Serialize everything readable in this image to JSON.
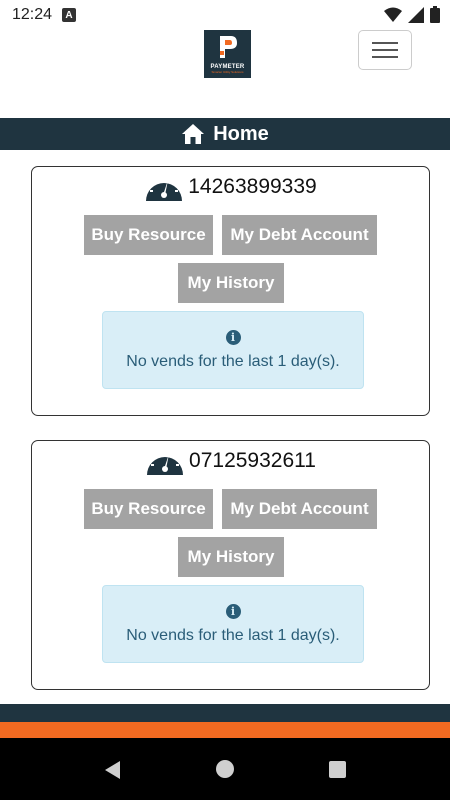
{
  "status_bar": {
    "time": "12:24",
    "notification_badge": "A",
    "icons": [
      "wifi-icon",
      "signal-icon",
      "battery-icon"
    ]
  },
  "header": {
    "logo_text": "PAYMETER",
    "logo_subtext": "Smarter Utility Solutions",
    "menu_icon": "hamburger-icon"
  },
  "nav": {
    "title": "Home",
    "icon": "home-icon"
  },
  "meters": [
    {
      "number": "14263899339",
      "buy_label": "Buy Resource",
      "debt_label": "My Debt Account",
      "history_label": "My History",
      "alert_text": "No vends for the last 1 day(s)."
    },
    {
      "number": "07125932611",
      "buy_label": "Buy Resource",
      "debt_label": "My Debt Account",
      "history_label": "My History",
      "alert_text": "No vends for the last 1 day(s)."
    }
  ],
  "colors": {
    "primary_dark": "#1f3440",
    "accent_orange": "#f26a21",
    "button_gray": "#a3a3a3",
    "alert_bg": "#d9eef7",
    "alert_text": "#2a5d78"
  }
}
